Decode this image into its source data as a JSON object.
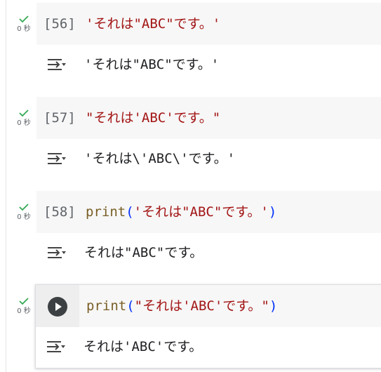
{
  "cells": [
    {
      "status": "0 秒",
      "count": "[56]",
      "code": "'それは\"ABC\"です。'",
      "output": "'それは\"ABC\"です。'"
    },
    {
      "status": "0 秒",
      "count": "[57]",
      "code": "\"それは'ABC'です。\"",
      "output": "'それは\\'ABC\\'です。'"
    },
    {
      "status": "0 秒",
      "count": "[58]",
      "func": "print",
      "open": "(",
      "arg": "'それは\"ABC\"です。'",
      "close": ")",
      "output": "それは\"ABC\"です。"
    },
    {
      "status": "0 秒",
      "func": "print",
      "open": "(",
      "arg": "\"それは'ABC'です。\"",
      "close": ")",
      "output": "それは'ABC'です。"
    }
  ],
  "icons": {
    "status": "check-icon",
    "output": "output-toggle-icon",
    "run": "play-icon"
  },
  "colors": {
    "check": "#34a853",
    "string": "#a31515",
    "function": "#795e26",
    "paren": "#0431fa",
    "code_bg": "#f7f7f7"
  }
}
